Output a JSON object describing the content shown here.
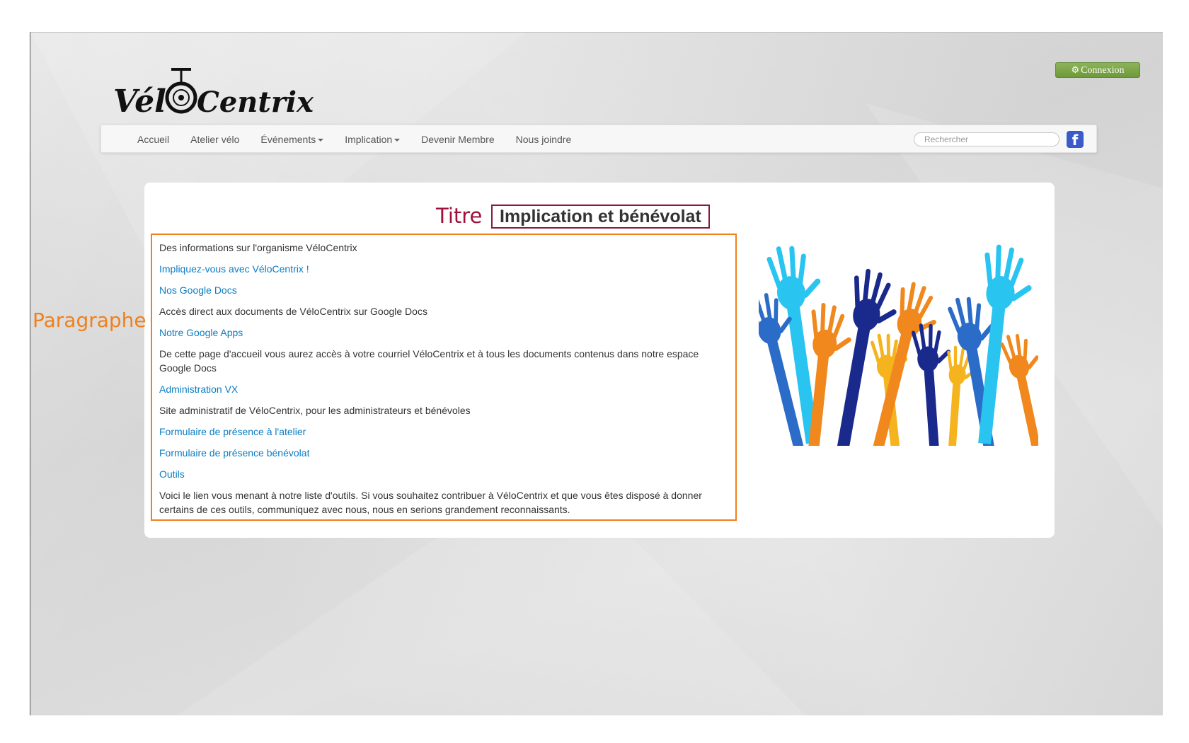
{
  "logo": {
    "text": "VéloCentrix"
  },
  "header": {
    "connexion_label": "Connexion"
  },
  "nav": {
    "items": [
      {
        "label": "Accueil",
        "dropdown": false
      },
      {
        "label": "Atelier vélo",
        "dropdown": false
      },
      {
        "label": "Événements",
        "dropdown": true
      },
      {
        "label": "Implication",
        "dropdown": true
      },
      {
        "label": "Devenir Membre",
        "dropdown": false
      },
      {
        "label": "Nous joindre",
        "dropdown": false
      }
    ],
    "search_placeholder": "Rechercher",
    "facebook_letter": "f"
  },
  "annotations": {
    "titre": "Titre",
    "paragraphe": "Paragraphe"
  },
  "content": {
    "title": "Implication et bénévolat",
    "paragraphs": [
      {
        "text": "Des informations sur l'organisme VéloCentrix",
        "link": false
      },
      {
        "text": "Impliquez-vous avec VéloCentrix !",
        "link": true
      },
      {
        "text": "Nos Google Docs",
        "link": true
      },
      {
        "text": "Accès direct aux documents de VéloCentrix sur Google Docs",
        "link": false
      },
      {
        "text": "Notre Google Apps",
        "link": true
      },
      {
        "text": "De cette page d'accueil vous aurez accès à votre courriel VéloCentrix et à tous les documents contenus dans notre espace Google Docs",
        "link": false
      },
      {
        "text": "Administration VX",
        "link": true
      },
      {
        "text": "Site administratif de VéloCentrix, pour les administrateurs et bénévoles",
        "link": false
      },
      {
        "text": "Formulaire de présence à l'atelier",
        "link": true
      },
      {
        "text": "Formulaire de présence bénévolat",
        "link": true
      },
      {
        "text": "Outils",
        "link": true
      },
      {
        "text": "Voici le lien vous menant à notre liste d'outils. Si vous souhaitez contribuer à VéloCentrix et que vous êtes disposé à donner certains de ces outils, communiquez avec nous, nous en serions grandement reconnaissants.",
        "link": false
      }
    ]
  },
  "colors": {
    "link": "#0a7cc2",
    "titre_annotation": "#a0103a",
    "paragraphe_annotation": "#f0801c",
    "connexion_button": "#7aa644",
    "hands": [
      "#29c4f0",
      "#f0881e",
      "#1a2a8c",
      "#2a6cc8",
      "#f5b41e"
    ]
  }
}
